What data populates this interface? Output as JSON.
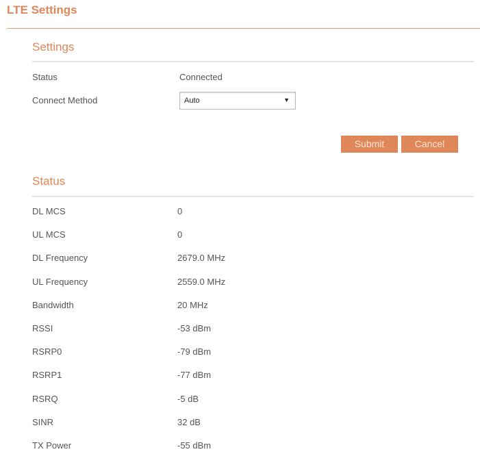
{
  "page_title": "LTE Settings",
  "settings": {
    "heading": "Settings",
    "status_label": "Status",
    "status_value": "Connected",
    "method_label": "Connect Method",
    "method_value": "Auto"
  },
  "buttons": {
    "submit": "Submit",
    "cancel": "Cancel"
  },
  "status": {
    "heading": "Status",
    "rows": [
      {
        "label": "DL MCS",
        "value": "0"
      },
      {
        "label": "UL MCS",
        "value": "0"
      },
      {
        "label": "DL Frequency",
        "value": "2679.0 MHz"
      },
      {
        "label": "UL Frequency",
        "value": "2559.0 MHz"
      },
      {
        "label": "Bandwidth",
        "value": "20 MHz"
      },
      {
        "label": "RSSI",
        "value": "-53 dBm"
      },
      {
        "label": "RSRP0",
        "value": "-79 dBm"
      },
      {
        "label": "RSRP1",
        "value": "-77 dBm"
      },
      {
        "label": "RSRQ",
        "value": "-5 dB"
      },
      {
        "label": "SINR",
        "value": "32 dB"
      },
      {
        "label": "TX Power",
        "value": "-55 dBm"
      }
    ]
  }
}
